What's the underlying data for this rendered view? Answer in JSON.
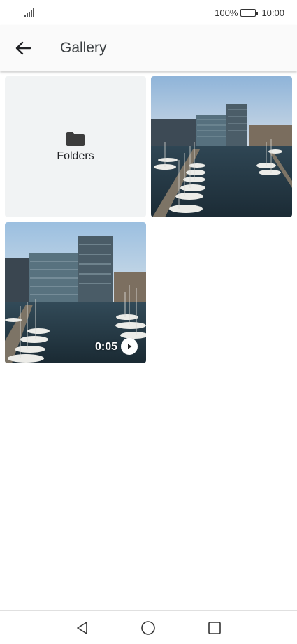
{
  "status_bar": {
    "battery": "100%",
    "time": "10:00",
    "icons": [
      "signal-icon",
      "battery-icon"
    ]
  },
  "app_bar": {
    "title": "Gallery",
    "back_icon": "arrow-left-icon"
  },
  "grid": {
    "folders_tile": {
      "label": "Folders",
      "icon": "folder-icon"
    },
    "items": [
      {
        "kind": "photo",
        "description_icon": "harbor-photo"
      },
      {
        "kind": "video",
        "duration": "0:05",
        "icon": "play-icon"
      }
    ]
  },
  "nav_bar": {
    "icons": [
      "back-triangle-icon",
      "home-circle-icon",
      "recents-square-icon"
    ]
  }
}
